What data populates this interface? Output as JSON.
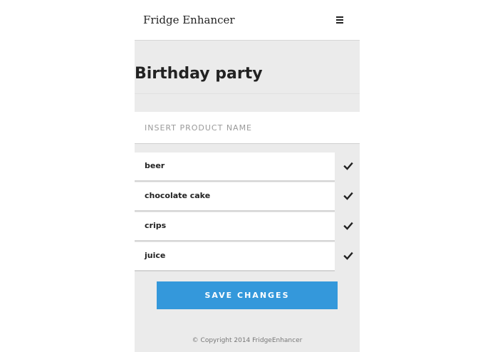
{
  "header": {
    "brand": "Fridge Enhancer",
    "menu_icon": "hamburger-menu-icon"
  },
  "page": {
    "title": "Birthday party"
  },
  "product_input": {
    "placeholder": "INSERT PRODUCT NAME",
    "value": ""
  },
  "items": [
    {
      "label": "beer",
      "icon": "checkmark-icon"
    },
    {
      "label": "chocolate cake",
      "icon": "checkmark-icon"
    },
    {
      "label": "crips",
      "icon": "checkmark-icon"
    },
    {
      "label": "juice",
      "icon": "checkmark-icon"
    }
  ],
  "actions": {
    "save_label": "SAVE CHANGES"
  },
  "footer": {
    "copyright": "© Copyright 2014 FridgeEnhancer"
  },
  "colors": {
    "accent": "#3498db",
    "panel_background": "#ebebeb",
    "text": "#222222"
  }
}
